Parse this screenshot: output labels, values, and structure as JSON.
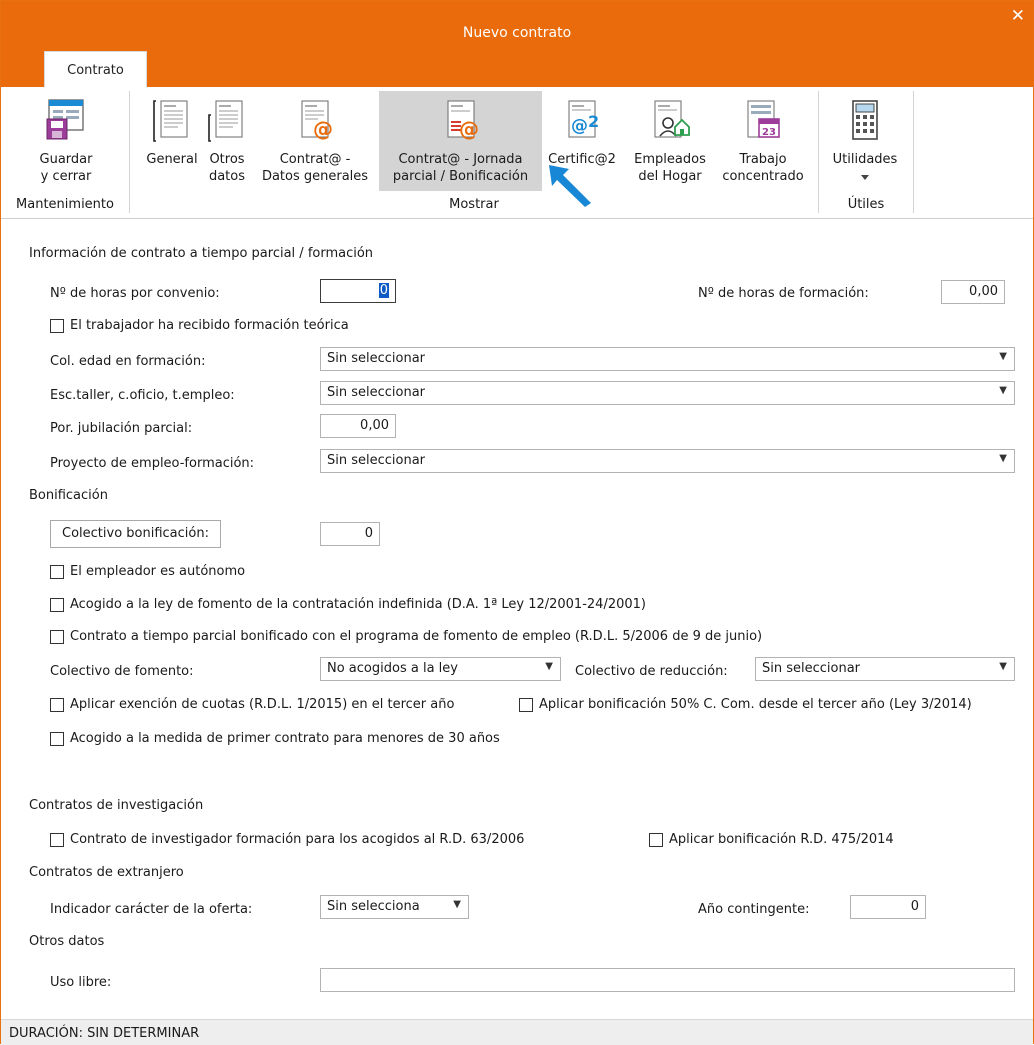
{
  "window": {
    "title": "Nuevo contrato",
    "close": "✕"
  },
  "tabs": [
    "Contrato"
  ],
  "ribbon": {
    "groups": {
      "mantenimiento": "Mantenimiento",
      "mostrar": "Mostrar",
      "utiles": "Útiles"
    },
    "buttons": {
      "guardar": "Guardar\ny cerrar",
      "general": "General",
      "otros": "Otros\ndatos",
      "contrat_datos": "Contrat@ -\nDatos generales",
      "contrat_jornada": "Contrat@ - Jornada\nparcial / Bonificación",
      "certific": "Certific@2",
      "empleados": "Empleados\ndel Hogar",
      "trabajo": "Trabajo\nconcentrado",
      "utilidades": "Utilidades"
    },
    "colors": {
      "orange": "#ea6b0b",
      "blue": "#1a8ad4",
      "green": "#2e9e4f",
      "purple": "#9c3d9a",
      "cursor": "#1787d6"
    }
  },
  "form": {
    "sec_parcial": "Información de contrato a tiempo parcial / formación",
    "horas_convenio_label": "Nº de horas por convenio:",
    "horas_convenio_value": "0",
    "horas_formacion_label": "Nº de horas de formación:",
    "horas_formacion_value": "0,00",
    "cb_formacion_teorica": "El trabajador ha recibido formación teórica",
    "col_edad_label": "Col. edad en formación:",
    "col_edad_value": "Sin seleccionar",
    "esc_taller_label": "Esc.taller, c.oficio, t.empleo:",
    "esc_taller_value": "Sin seleccionar",
    "jubilacion_label": "Por. jubilación parcial:",
    "jubilacion_value": "0,00",
    "proyecto_label": "Proyecto de empleo-formación:",
    "proyecto_value": "Sin seleccionar",
    "sec_bonificacion": "Bonificación",
    "colectivo_bonif_btn": "Colectivo bonificación:",
    "colectivo_bonif_value": "0",
    "cb_autonomo": "El empleador es autónomo",
    "cb_ley_fomento": "Acogido a la ley de fomento de la contratación indefinida (D.A. 1ª Ley 12/2001-24/2001)",
    "cb_parcial_bonificado": "Contrato a tiempo parcial bonificado con el programa de fomento de empleo (R.D.L. 5/2006 de 9 de junio)",
    "col_fomento_label": "Colectivo de fomento:",
    "col_fomento_value": "No acogidos a la ley",
    "col_reduccion_label": "Colectivo de reducción:",
    "col_reduccion_value": "Sin seleccionar",
    "cb_exencion": "Aplicar exención de cuotas (R.D.L. 1/2015) en el tercer año",
    "cb_bonif50": "Aplicar bonificación 50% C. Com. desde el tercer año (Ley 3/2014)",
    "cb_primer_contrato": "Acogido a la medida de primer contrato para menores de 30 años",
    "sec_investigacion": "Contratos de investigación",
    "cb_investigador": "Contrato de investigador formación para los acogidos al R.D. 63/2006",
    "cb_bonif475": "Aplicar bonificación R.D. 475/2014",
    "sec_extranjero": "Contratos de extranjero",
    "indicador_label": "Indicador carácter de la oferta:",
    "indicador_value": "Sin selecciona",
    "anio_label": "Año contingente:",
    "anio_value": "0",
    "sec_otros": "Otros datos",
    "uso_libre_label": "Uso libre:",
    "uso_libre_value": ""
  },
  "status": {
    "duracion": "DURACIÓN: SIN DETERMINAR"
  }
}
